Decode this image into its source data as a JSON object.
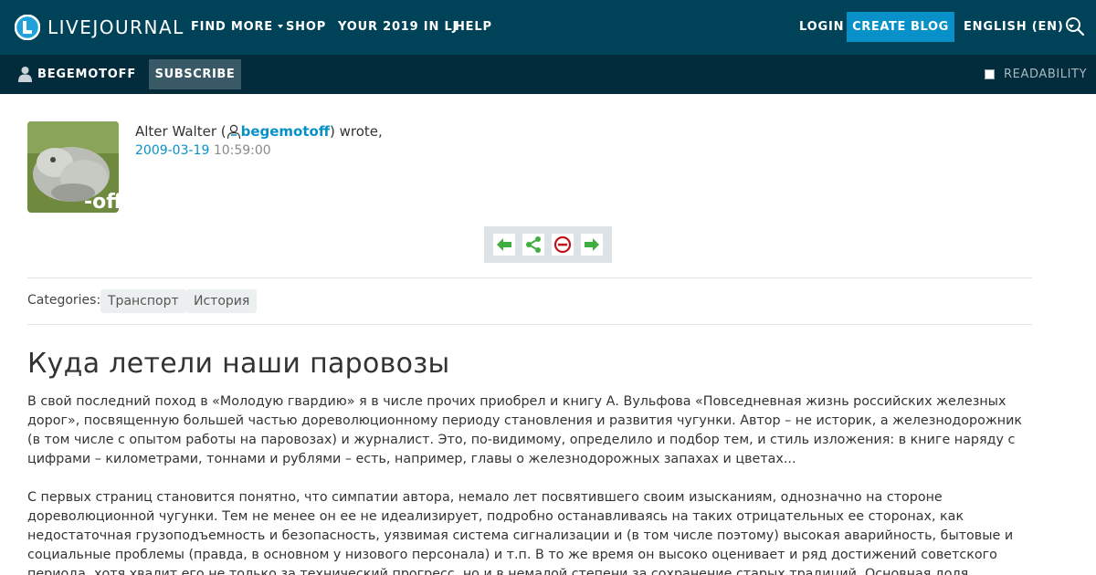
{
  "topnav": {
    "logo_text": "LIVEJOURNAL",
    "items": [
      "FIND MORE",
      "SHOP",
      "YOUR 2019 IN LJ",
      "HELP"
    ],
    "login": "LOGIN",
    "create_blog": "CREATE BLOG",
    "language": "ENGLISH (EN)",
    "search_icon": "search-icon"
  },
  "subbar": {
    "username": "BEGEMOTOFF",
    "subscribe": "SUBSCRIBE",
    "readability": "READABILITY"
  },
  "post": {
    "author_name": "Alter Walter (",
    "author_user": "begemotoff",
    "author_suffix": ") wrote,",
    "date": "2009-03-19",
    "time": "10:59:00",
    "avatar_label": "-off",
    "categories_label": "Categories:",
    "categories": [
      "Транспорт",
      "История"
    ],
    "title": "Куда летели наши паровозы",
    "paragraphs": [
      "В свой последний поход в «Молодую гвардию» я в числе прочих приобрел и книгу А. Вульфова «Повседневная жизнь российских железных дорог», посвященную большей частью дореволюционному периоду становления и развития чугунки. Автор – не историк, а железнодорожник (в том числе с опытом работы на паровозах) и журналист. Это, по-видимому, определило и подбор тем, и стиль изложения: в книге наряду с цифрами – километрами, тоннами и рублями – есть, например, главы о железнодорожных запахах и цветах...",
      "С первых страниц становится понятно, что симпатии автора, немало лет посвятившего своим изысканиям, однозначно на стороне дореволюционной чугунки. Тем не менее он ее не идеализирует, подробно останавливаясь на таких отрицательных ее сторонах, как недостаточная грузоподъемность и безопасность, уязвимая система сигнализации и (в том числе поэтому) высокая аварийность, бытовые и социальные проблемы (правда, в основном у низового персонала) и т.п. В то же время он высоко оценивает и ряд достижений советского периода, хотя хвалит его не только за технический прогресс, но и в немалой степени за сохранение старых традиций. Основная доля антипатии автора достается нынешнему времени – периоду, когда среди прочего"
    ]
  },
  "colors": {
    "topbar": "#004359",
    "subbar": "#022c3c",
    "accent": "#0891c8"
  }
}
